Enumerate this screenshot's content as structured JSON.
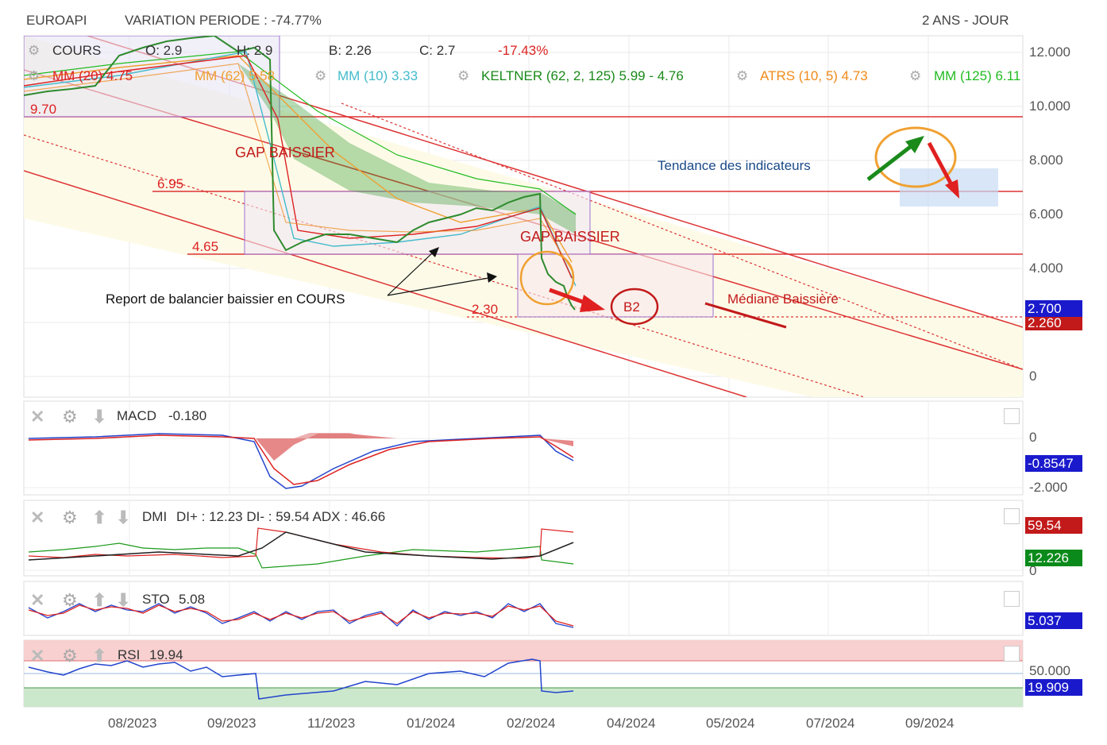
{
  "header": {
    "symbol": "EUROAPI",
    "variation": "VARIATION PERIODE : -74.77%",
    "period": "2 ANS - JOUR"
  },
  "legend": {
    "cours": "COURS",
    "o": "O: 2.9",
    "h": "H: 2.9",
    "b": "B: 2.26",
    "c": "C: 2.7",
    "pct": "-17.43%",
    "mm20": "MM (20) 4.75",
    "mm62": "MM (62) 5.58",
    "mm10": "MM (10) 3.33",
    "keltner": "KELTNER (62, 2, 125) 5.99 - 4.76",
    "atrs": "ATRS (10, 5) 4.73",
    "mm125": "MM (125) 6.11"
  },
  "annotations": {
    "level_970": "9.70",
    "level_695": "6.95",
    "level_465": "4.65",
    "level_230": "2.30",
    "gap1": "GAP BAISSIER",
    "gap2": "GAP BAISSIER",
    "tendance": "Tendance des indicateurs",
    "report": "Report de balancier baissier en COURS",
    "b2": "B2",
    "mediane": "Médiane Baissière"
  },
  "price_axis": {
    "ticks": [
      "12.000",
      "10.000",
      "8.000",
      "6.000",
      "4.000",
      "0"
    ],
    "last_label": "2.700",
    "low_label": "2.260"
  },
  "macd": {
    "title": "MACD",
    "value": "-0.180",
    "tick0": "0",
    "tick1": "-2.000",
    "last": "-0.8547"
  },
  "dmi": {
    "title": "DMI",
    "value": "DI+ : 12.23 DI- : 59.54 ADX : 46.66",
    "di_minus": "59.54",
    "di_plus": "12.226",
    "tick0": "0"
  },
  "sto": {
    "title": "STO",
    "value": "5.08",
    "last": "5.037"
  },
  "rsi": {
    "title": "RSI",
    "value": "19.94",
    "tick": "50.000",
    "last": "19.909"
  },
  "x_axis": [
    "08/2023",
    "09/2023",
    "11/2023",
    "01/2024",
    "02/2024",
    "04/2024",
    "05/2024",
    "07/2024",
    "09/2024"
  ],
  "colors": {
    "price": "#2e8b2e",
    "mm20": "#d22",
    "mm62": "#f0a030",
    "mm10": "#44bbcc",
    "keltner": "#1a8a1a",
    "atrs": "#f08a1a",
    "mm125": "#22bb22",
    "axis_last": "#1a1acc",
    "axis_red": "#c21a1a",
    "axis_green": "#0a8a1a"
  },
  "chart_data": {
    "type": "line",
    "title": "EUROAPI",
    "xlabel": "",
    "ylabel": "",
    "ylim": [
      0,
      12.5
    ],
    "x": [
      "2023-07",
      "2023-08",
      "2023-09",
      "2023-10",
      "2023-11",
      "2023-12",
      "2024-01",
      "2024-02",
      "2024-03"
    ],
    "series": [
      {
        "name": "COURS",
        "values": [
          9.8,
          11.0,
          11.8,
          4.6,
          5.0,
          5.4,
          6.2,
          6.9,
          2.7
        ]
      },
      {
        "name": "MM (20)",
        "values": [
          9.9,
          10.8,
          11.5,
          5.6,
          5.0,
          5.3,
          6.0,
          6.6,
          4.75
        ]
      },
      {
        "name": "MM (62)",
        "values": [
          10.0,
          10.4,
          11.2,
          7.0,
          5.6,
          5.4,
          5.8,
          6.3,
          5.58
        ]
      },
      {
        "name": "MM (125)",
        "values": [
          10.2,
          10.3,
          10.8,
          8.5,
          7.2,
          6.3,
          6.2,
          6.3,
          6.11
        ]
      }
    ],
    "levels": [
      9.7,
      6.95,
      4.65,
      2.3
    ],
    "grid": true
  }
}
